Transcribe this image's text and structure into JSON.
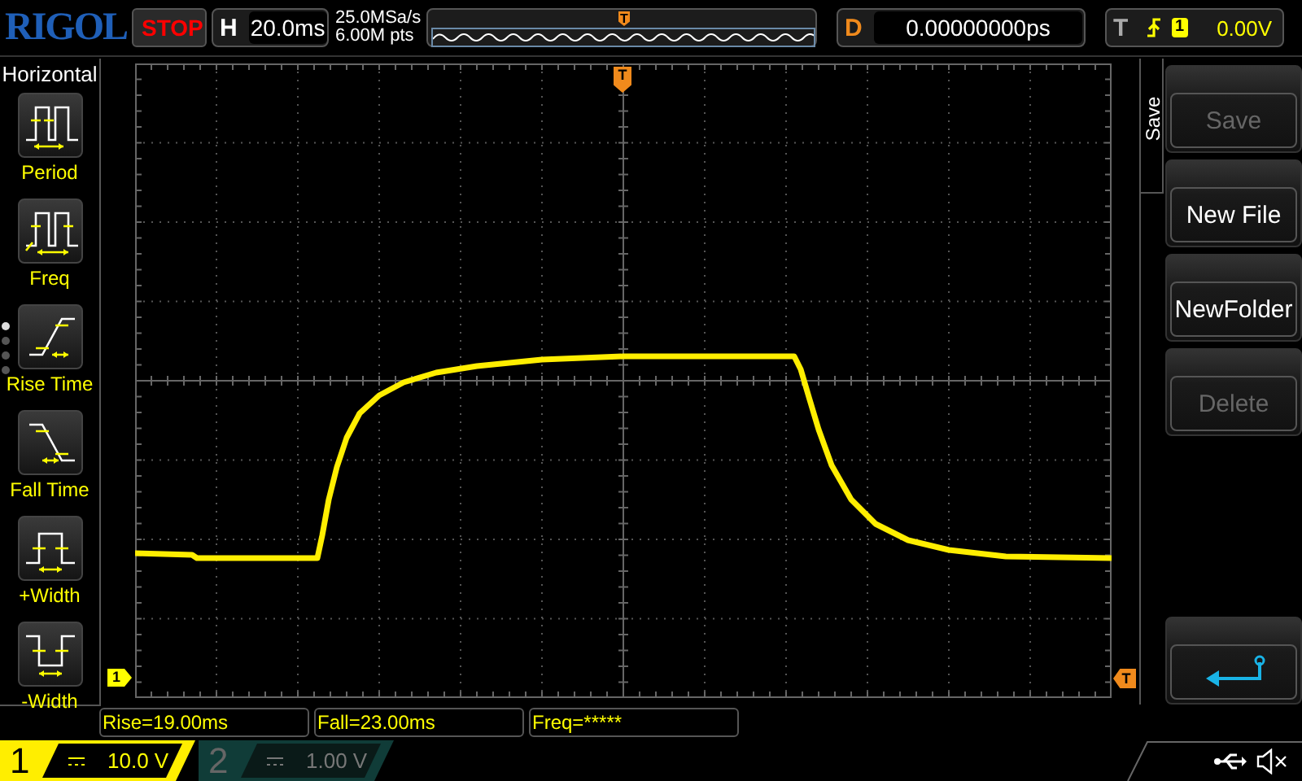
{
  "brand": "RIGOL",
  "run_state": {
    "label": "STOP",
    "kind": "stop"
  },
  "timebase": {
    "label": "H",
    "value": "20.0ms"
  },
  "sample": {
    "rate": "25.0MSa/s",
    "depth": "6.00M pts"
  },
  "memory_bar": {
    "marker": "T"
  },
  "delay": {
    "label": "D",
    "value": "0.00000000ps"
  },
  "trigger": {
    "label": "T",
    "source": "1",
    "level": "0.00V"
  },
  "sidebar": {
    "title": "Horizontal",
    "items": [
      {
        "label": "Period"
      },
      {
        "label": "Freq"
      },
      {
        "label": "Rise Time"
      },
      {
        "label": "Fall Time"
      },
      {
        "label": "+Width"
      },
      {
        "label": "-Width"
      }
    ],
    "pages": [
      {
        "selected": true
      },
      {
        "selected": false
      },
      {
        "selected": false
      },
      {
        "selected": false
      }
    ]
  },
  "grid": {
    "trigger_position_marker": "T",
    "channel_marker": "1",
    "trigger_level_marker": "T"
  },
  "menu": {
    "title": "Save",
    "buttons": [
      {
        "kind": "text",
        "label": "Save",
        "disabled": true
      },
      {
        "kind": "text",
        "label": "New File",
        "disabled": false
      },
      {
        "kind": "text",
        "label": "NewFolder",
        "disabled": false
      },
      {
        "kind": "text",
        "label": "Delete",
        "disabled": true
      },
      {
        "kind": "spacer"
      },
      {
        "kind": "back"
      }
    ]
  },
  "measurements": [
    "Rise=19.00ms",
    "Fall=23.00ms",
    "Freq=*****"
  ],
  "channels": [
    {
      "number": "1",
      "scale": "10.0 V",
      "active": true
    },
    {
      "number": "2",
      "scale": "1.00 V",
      "active": false
    }
  ]
}
